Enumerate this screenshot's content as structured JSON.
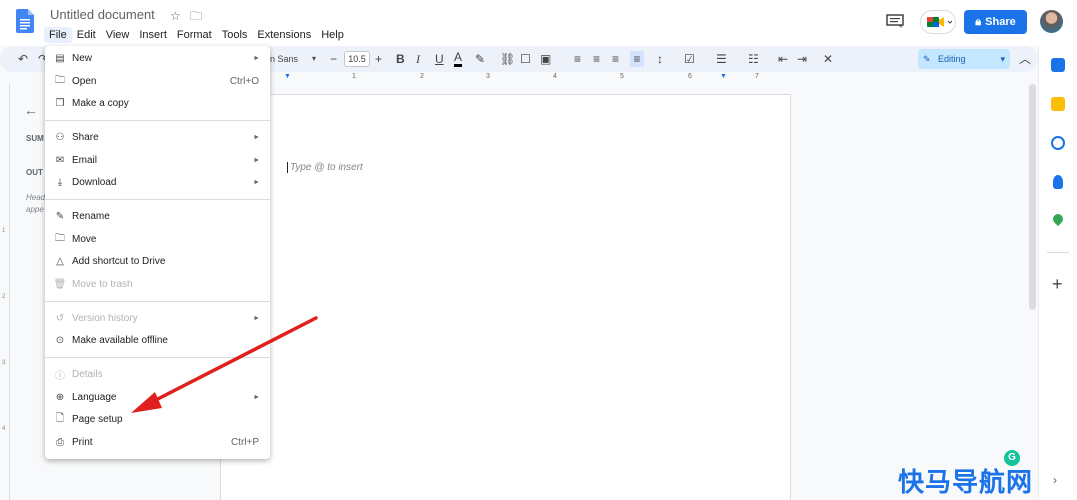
{
  "app": {
    "doc_title": "Untitled document",
    "share_label": "Share",
    "editing_mode": "Editing"
  },
  "menubar": [
    "File",
    "Edit",
    "View",
    "Insert",
    "Format",
    "Tools",
    "Extensions",
    "Help"
  ],
  "toolbar": {
    "font_name": "en Sans",
    "font_size": "10.5",
    "minus": "−",
    "plus": "+",
    "bold": "B",
    "italic": "I",
    "underline": "U",
    "text_color": "A"
  },
  "ruler": [
    "1",
    "1",
    "2",
    "3",
    "4",
    "5",
    "6",
    "7"
  ],
  "vruler": [
    "1",
    "2",
    "3",
    "4"
  ],
  "outline": {
    "summary_label": "SUM",
    "outline_label": "OUT",
    "hint": "Head appe"
  },
  "document": {
    "placeholder": "Type @ to insert"
  },
  "file_menu": {
    "items": [
      {
        "label": "New",
        "shortcut": "",
        "submenu": true,
        "disabled": false,
        "icon": "doc-icon"
      },
      {
        "label": "Open",
        "shortcut": "Ctrl+O",
        "submenu": false,
        "disabled": false,
        "icon": "folder-icon"
      },
      {
        "label": "Make a copy",
        "shortcut": "",
        "submenu": false,
        "disabled": false,
        "icon": "copy-icon"
      },
      {
        "label": "Share",
        "shortcut": "",
        "submenu": true,
        "disabled": false,
        "icon": "person-add-icon"
      },
      {
        "label": "Email",
        "shortcut": "",
        "submenu": true,
        "disabled": false,
        "icon": "email-icon"
      },
      {
        "label": "Download",
        "shortcut": "",
        "submenu": true,
        "disabled": false,
        "icon": "download-icon"
      },
      {
        "label": "Rename",
        "shortcut": "",
        "submenu": false,
        "disabled": false,
        "icon": "rename-icon"
      },
      {
        "label": "Move",
        "shortcut": "",
        "submenu": false,
        "disabled": false,
        "icon": "move-folder-icon"
      },
      {
        "label": "Add shortcut to Drive",
        "shortcut": "",
        "submenu": false,
        "disabled": false,
        "icon": "drive-shortcut-icon"
      },
      {
        "label": "Move to trash",
        "shortcut": "",
        "submenu": false,
        "disabled": true,
        "icon": "trash-icon"
      },
      {
        "label": "Version history",
        "shortcut": "",
        "submenu": true,
        "disabled": true,
        "icon": "history-icon"
      },
      {
        "label": "Make available offline",
        "shortcut": "",
        "submenu": false,
        "disabled": false,
        "icon": "offline-icon"
      },
      {
        "label": "Details",
        "shortcut": "",
        "submenu": false,
        "disabled": true,
        "icon": "info-icon"
      },
      {
        "label": "Language",
        "shortcut": "",
        "submenu": true,
        "disabled": false,
        "icon": "globe-icon"
      },
      {
        "label": "Page setup",
        "shortcut": "",
        "submenu": false,
        "disabled": false,
        "icon": "page-icon"
      },
      {
        "label": "Print",
        "shortcut": "Ctrl+P",
        "submenu": false,
        "disabled": false,
        "icon": "print-icon"
      }
    ]
  },
  "watermark": "快马导航网",
  "grammarly": "G",
  "colors": {
    "accent": "#1a73e8",
    "arrow": "#e0201c",
    "editing_bg": "#c2e7ff"
  }
}
